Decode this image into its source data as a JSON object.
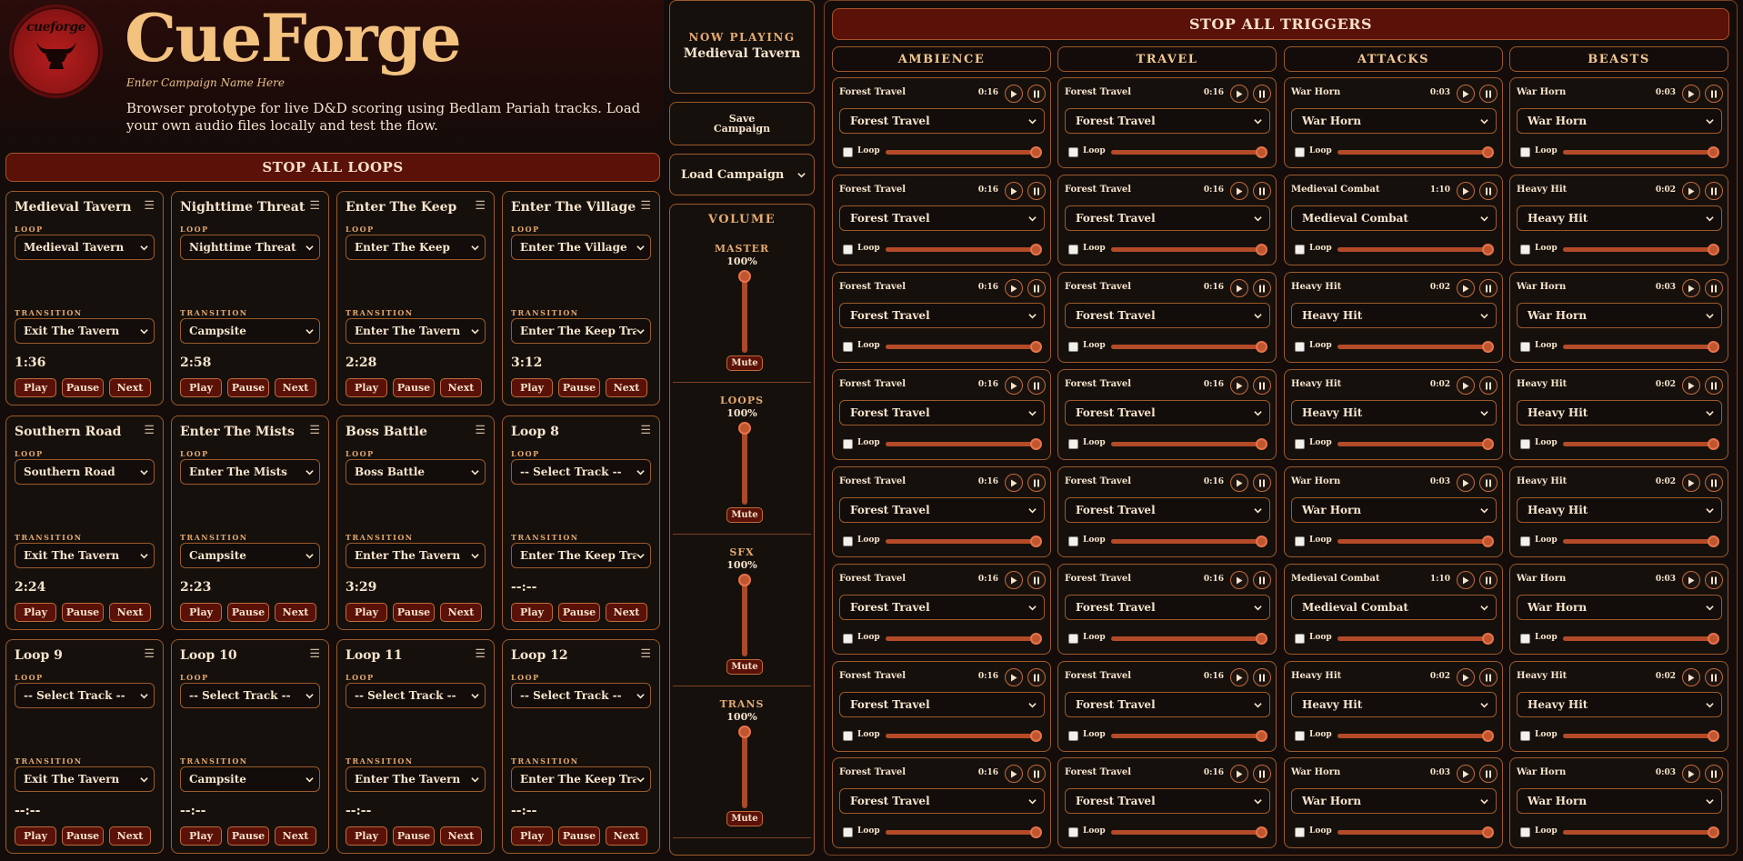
{
  "app": {
    "title": "CueForge",
    "logo_text": "cueforge",
    "campaign_name": "Enter Campaign Name Here",
    "subtitle": "Browser prototype for live D&D scoring using Bedlam Pariah tracks. Load your own audio files locally and test the flow."
  },
  "colors": {
    "accent": "#f3c27f",
    "button_bg": "#5a1108",
    "border": "#9c5a2a",
    "slider": "#b44b28"
  },
  "labels": {
    "stop_all_loops": "STOP ALL LOOPS",
    "stop_all_triggers": "STOP ALL TRIGGERS",
    "loop": "LOOP",
    "transition": "TRANSITION",
    "play": "Play",
    "pause": "Pause",
    "next": "Next",
    "menu_icon": "☰",
    "trigger_loop": "Loop"
  },
  "loops": [
    {
      "title": "Medieval Tavern",
      "loop": "Medieval Tavern",
      "transition": "Exit The Tavern",
      "time": "1:36"
    },
    {
      "title": "Nighttime Threat",
      "loop": "Nighttime Threat",
      "transition": "Campsite",
      "time": "2:58"
    },
    {
      "title": "Enter The Keep",
      "loop": "Enter The Keep",
      "transition": "Enter The Tavern",
      "time": "2:28"
    },
    {
      "title": "Enter The Village",
      "loop": "Enter The Village",
      "transition": "Enter The Keep Transition",
      "time": "3:12"
    },
    {
      "title": "Southern Road",
      "loop": "Southern Road",
      "transition": "Exit The Tavern",
      "time": "2:24"
    },
    {
      "title": "Enter The Mists",
      "loop": "Enter The Mists",
      "transition": "Campsite",
      "time": "2:23"
    },
    {
      "title": "Boss Battle",
      "loop": "Boss Battle",
      "transition": "Enter The Tavern",
      "time": "3:29"
    },
    {
      "title": "Loop 8",
      "loop": "-- Select Track --",
      "transition": "Enter The Keep Transition",
      "time": "--:--"
    },
    {
      "title": "Loop 9",
      "loop": "-- Select Track --",
      "transition": "Exit The Tavern",
      "time": "--:--"
    },
    {
      "title": "Loop 10",
      "loop": "-- Select Track --",
      "transition": "Campsite",
      "time": "--:--"
    },
    {
      "title": "Loop 11",
      "loop": "-- Select Track --",
      "transition": "Enter The Tavern",
      "time": "--:--"
    },
    {
      "title": "Loop 12",
      "loop": "-- Select Track --",
      "transition": "Enter The Keep Transition",
      "time": "--:--"
    }
  ],
  "now_playing": {
    "label": "NOW PLAYING",
    "track": "Medieval Tavern"
  },
  "save_campaign": [
    "Save",
    "Campaign"
  ],
  "load_campaign": "Load Campaign",
  "volume": {
    "title": "VOLUME",
    "mute_label": "Mute",
    "groups": [
      {
        "name": "MASTER",
        "percent": "100%",
        "level": 1.0
      },
      {
        "name": "LOOPS",
        "percent": "100%",
        "level": 1.0
      },
      {
        "name": "SFX",
        "percent": "100%",
        "level": 1.0
      },
      {
        "name": "TRANS",
        "percent": "100%",
        "level": 1.0
      }
    ]
  },
  "trigger_columns": [
    {
      "heading": "AMBIENCE",
      "cards": [
        {
          "name": "Forest Travel",
          "time": "0:16",
          "select": "Forest Travel",
          "level": 1.0
        },
        {
          "name": "Forest Travel",
          "time": "0:16",
          "select": "Forest Travel",
          "level": 1.0
        },
        {
          "name": "Forest Travel",
          "time": "0:16",
          "select": "Forest Travel",
          "level": 1.0
        },
        {
          "name": "Forest Travel",
          "time": "0:16",
          "select": "Forest Travel",
          "level": 1.0
        },
        {
          "name": "Forest Travel",
          "time": "0:16",
          "select": "Forest Travel",
          "level": 1.0
        },
        {
          "name": "Forest Travel",
          "time": "0:16",
          "select": "Forest Travel",
          "level": 1.0
        },
        {
          "name": "Forest Travel",
          "time": "0:16",
          "select": "Forest Travel",
          "level": 1.0
        },
        {
          "name": "Forest Travel",
          "time": "0:16",
          "select": "Forest Travel",
          "level": 1.0
        }
      ]
    },
    {
      "heading": "TRAVEL",
      "cards": [
        {
          "name": "Forest Travel",
          "time": "0:16",
          "select": "Forest Travel",
          "level": 1.0
        },
        {
          "name": "Forest Travel",
          "time": "0:16",
          "select": "Forest Travel",
          "level": 1.0
        },
        {
          "name": "Forest Travel",
          "time": "0:16",
          "select": "Forest Travel",
          "level": 1.0
        },
        {
          "name": "Forest Travel",
          "time": "0:16",
          "select": "Forest Travel",
          "level": 1.0
        },
        {
          "name": "Forest Travel",
          "time": "0:16",
          "select": "Forest Travel",
          "level": 1.0
        },
        {
          "name": "Forest Travel",
          "time": "0:16",
          "select": "Forest Travel",
          "level": 1.0
        },
        {
          "name": "Forest Travel",
          "time": "0:16",
          "select": "Forest Travel",
          "level": 1.0
        },
        {
          "name": "Forest Travel",
          "time": "0:16",
          "select": "Forest Travel",
          "level": 1.0
        }
      ]
    },
    {
      "heading": "ATTACKS",
      "cards": [
        {
          "name": "War Horn",
          "time": "0:03",
          "select": "War Horn",
          "level": 1.0
        },
        {
          "name": "Medieval Combat",
          "time": "1:10",
          "select": "Medieval Combat",
          "level": 1.0
        },
        {
          "name": "Heavy Hit",
          "time": "0:02",
          "select": "Heavy Hit",
          "level": 1.0
        },
        {
          "name": "Heavy Hit",
          "time": "0:02",
          "select": "Heavy Hit",
          "level": 1.0
        },
        {
          "name": "War Horn",
          "time": "0:03",
          "select": "War Horn",
          "level": 1.0
        },
        {
          "name": "Medieval Combat",
          "time": "1:10",
          "select": "Medieval Combat",
          "level": 1.0
        },
        {
          "name": "Heavy Hit",
          "time": "0:02",
          "select": "Heavy Hit",
          "level": 1.0
        },
        {
          "name": "War Horn",
          "time": "0:03",
          "select": "War Horn",
          "level": 1.0
        }
      ]
    },
    {
      "heading": "BEASTS",
      "cards": [
        {
          "name": "War Horn",
          "time": "0:03",
          "select": "War Horn",
          "level": 1.0
        },
        {
          "name": "Heavy Hit",
          "time": "0:02",
          "select": "Heavy Hit",
          "level": 1.0
        },
        {
          "name": "War Horn",
          "time": "0:03",
          "select": "War Horn",
          "level": 1.0
        },
        {
          "name": "Heavy Hit",
          "time": "0:02",
          "select": "Heavy Hit",
          "level": 1.0
        },
        {
          "name": "Heavy Hit",
          "time": "0:02",
          "select": "Heavy Hit",
          "level": 1.0
        },
        {
          "name": "War Horn",
          "time": "0:03",
          "select": "War Horn",
          "level": 1.0
        },
        {
          "name": "Heavy Hit",
          "time": "0:02",
          "select": "Heavy Hit",
          "level": 1.0
        },
        {
          "name": "War Horn",
          "time": "0:03",
          "select": "War Horn",
          "level": 1.0
        }
      ]
    }
  ]
}
